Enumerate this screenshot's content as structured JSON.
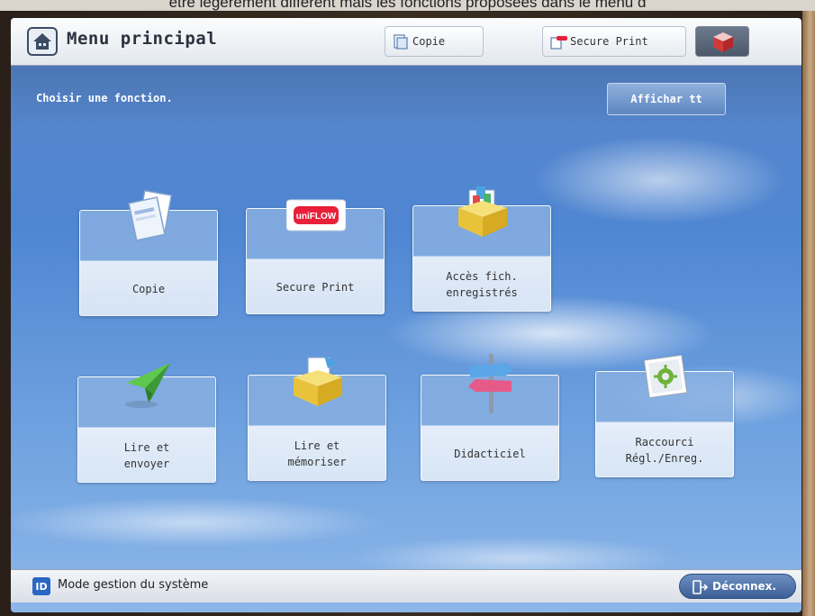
{
  "caption_text": "être légèrement différent mais les fonctions proposées dans le menu d",
  "header": {
    "title": "Menu principal",
    "tabs": [
      {
        "label": "Copie"
      },
      {
        "label": "Secure Print"
      }
    ]
  },
  "subheader": {
    "instruction": "Choisir une fonction.",
    "show_all_label": "Affichar tt"
  },
  "tiles": [
    {
      "label": "Copie",
      "icon": "copy-icon"
    },
    {
      "label": "Secure Print",
      "icon": "uniflow-logo",
      "logo_text": "uniFLOW"
    },
    {
      "label": "Accès fich.\nenregistrés",
      "icon": "stored-files-icon"
    },
    {
      "label": "Lire et\nenvoyer",
      "icon": "paper-plane-icon"
    },
    {
      "label": "Lire et\nmémoriser",
      "icon": "scan-store-icon"
    },
    {
      "label": "Didacticiel",
      "icon": "signpost-icon"
    },
    {
      "label": "Raccourci\nRégl./Enreg.",
      "icon": "shortcut-icon"
    }
  ],
  "footer": {
    "id_badge": "ID",
    "mode_label": "Mode gestion du système",
    "logout_label": "Déconnex."
  },
  "colors": {
    "sky": "#4f86d2",
    "logout": "#3c5f96",
    "uniflow_red": "#e8203a"
  }
}
